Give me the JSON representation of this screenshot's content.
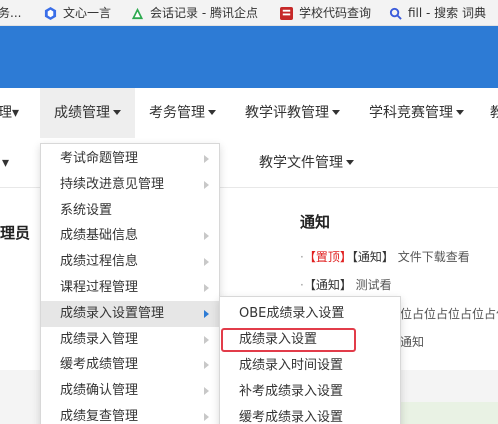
{
  "bookmarks": [
    {
      "label": "务...",
      "icon": "page-icon"
    },
    {
      "label": "文心一言",
      "icon": "wenxin-icon"
    },
    {
      "label": "会话记录 - 腾讯企点",
      "icon": "qidian-icon"
    },
    {
      "label": "学校代码查询",
      "icon": "school-icon"
    },
    {
      "label": "fill - 搜索 词典",
      "icon": "search-icon"
    }
  ],
  "nav": {
    "items": [
      "理▾",
      "成绩管理",
      "考务管理",
      "教学评教管理",
      "学科竞赛管理",
      "教"
    ],
    "row2": [
      "▾",
      "教学文件管理"
    ]
  },
  "content": {
    "left_title": "理员",
    "notice_title": "通知",
    "notices": [
      {
        "tag1": "【置顶】",
        "tag2": "【通知】",
        "text": "文件下载查看"
      },
      {
        "tag2": "【通知】",
        "text": "测试看"
      }
    ],
    "fragments": [
      "位占位占位占位占位",
      "通知"
    ]
  },
  "dropdown": {
    "items": [
      {
        "label": "考试命题管理",
        "arrow": true
      },
      {
        "label": "持续改进意见管理",
        "arrow": true
      },
      {
        "label": "系统设置",
        "arrow": false
      },
      {
        "label": "成绩基础信息",
        "arrow": true
      },
      {
        "label": "成绩过程信息",
        "arrow": true
      },
      {
        "label": "课程过程管理",
        "arrow": true
      },
      {
        "label": "成绩录入设置管理",
        "arrow": true
      },
      {
        "label": "成绩录入管理",
        "arrow": true
      },
      {
        "label": "缓考成绩管理",
        "arrow": true
      },
      {
        "label": "成绩确认管理",
        "arrow": true
      },
      {
        "label": "成绩复查管理",
        "arrow": true
      }
    ]
  },
  "submenu": {
    "items": [
      {
        "label": "OBE成绩录入设置"
      },
      {
        "label": "成绩录入设置"
      },
      {
        "label": "成绩录入时间设置"
      },
      {
        "label": "补考成绩录入设置"
      },
      {
        "label": "缓考成绩录入设置"
      }
    ]
  },
  "colors": {
    "header": "#2d7bd5",
    "highlight": "#e23c4a",
    "red_tag": "#e02020"
  }
}
